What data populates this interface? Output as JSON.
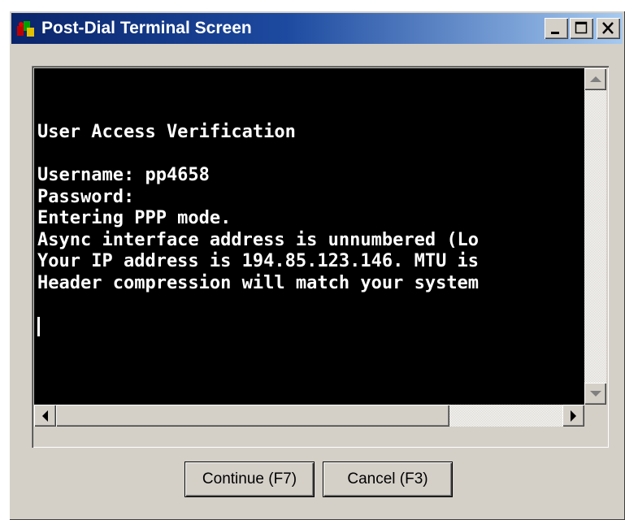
{
  "window": {
    "title": "Post-Dial Terminal Screen",
    "title_bar_colors": {
      "start": "#0a246a",
      "end": "#a6caf0"
    }
  },
  "title_buttons": [
    "minimize-icon",
    "maximize-icon",
    "close-icon"
  ],
  "terminal": {
    "background": "#000000",
    "foreground": "#ffffff",
    "lines": [
      "User Access Verification",
      "",
      "Username: pp4658",
      "Password:",
      "Entering PPP mode.",
      "Async interface address is unnumbered (Lo",
      "Your IP address is 194.85.123.146. MTU is",
      "Header compression will match your system"
    ]
  },
  "buttons": {
    "continue_label": "Continue (F7)",
    "cancel_label": "Cancel (F3)"
  }
}
